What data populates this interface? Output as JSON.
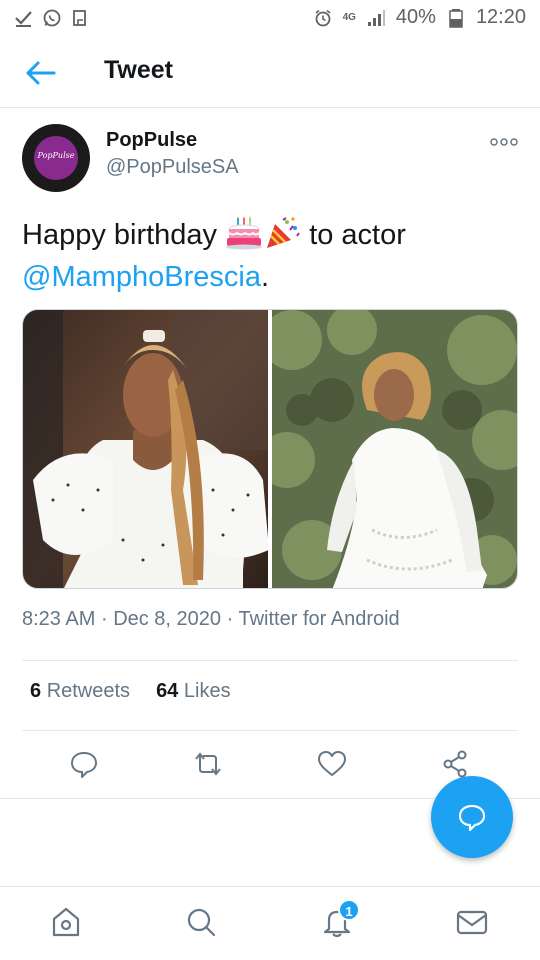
{
  "status_bar": {
    "battery_percent": "40%",
    "time": "12:20",
    "network": "4G",
    "icons": [
      "check-icon",
      "whatsapp-icon",
      "clipboard-icon",
      "alarm-icon",
      "signal-icon",
      "battery-icon"
    ]
  },
  "header": {
    "title": "Tweet",
    "back_icon": "back-arrow-icon"
  },
  "tweet": {
    "user": {
      "name": "PopPulse",
      "handle": "@PopPulseSA",
      "avatar_text": "PopPulse"
    },
    "text_before": "Happy birthday",
    "emojis": [
      "birthday-cake-emoji",
      "party-popper-emoji"
    ],
    "text_middle": "to actor",
    "mention": "@MamphoBrescia",
    "text_after": ".",
    "images": [
      "photo-woman-braids-polka-dot-dress",
      "photo-woman-white-dress-garden"
    ],
    "meta": {
      "time": "8:23 AM",
      "separator": "·",
      "date": "Dec 8, 2020",
      "source": "Twitter for Android"
    },
    "stats": {
      "retweets_count": "6",
      "retweets_label": "Retweets",
      "likes_count": "64",
      "likes_label": "Likes"
    }
  },
  "actions": [
    "reply-icon",
    "retweet-icon",
    "like-icon",
    "share-icon"
  ],
  "fab": {
    "icon": "compose-reply-icon"
  },
  "bottom_nav": {
    "items": [
      "home-icon",
      "search-icon",
      "notifications-icon",
      "messages-icon"
    ],
    "notification_badge": "1"
  },
  "colors": {
    "accent": "#1da1f2",
    "text": "#14171a",
    "secondary_text": "#657786",
    "divider": "#e1e8ed"
  }
}
